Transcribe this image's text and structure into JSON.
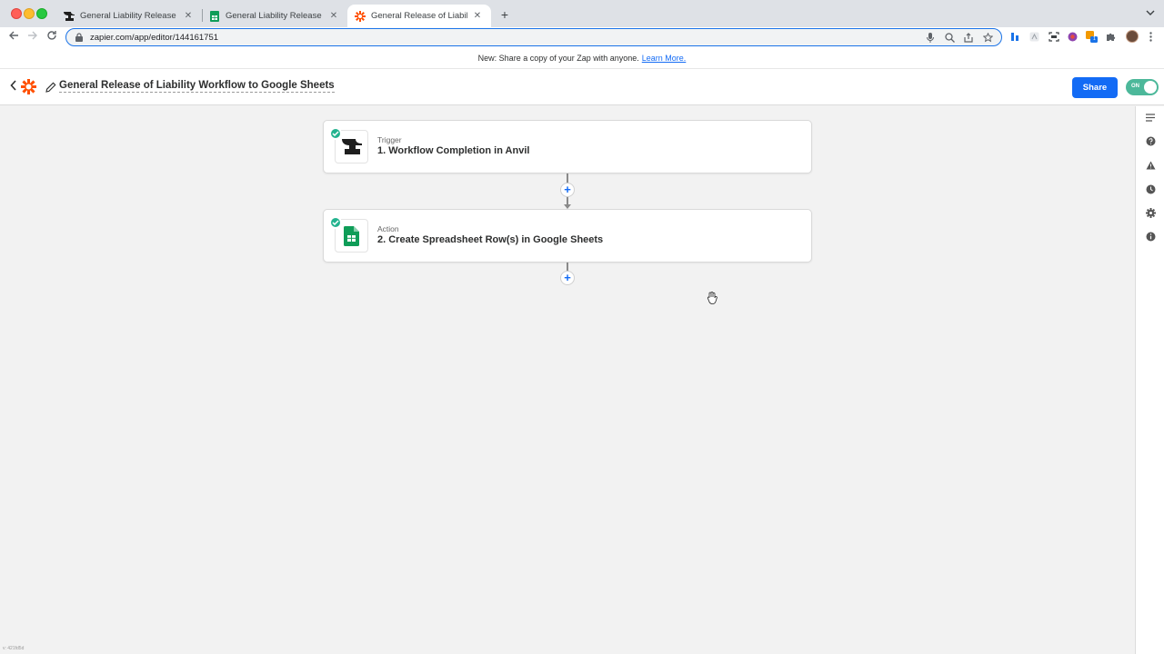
{
  "browser": {
    "tabs": [
      {
        "title": "General Liability Release - Anvil",
        "icon": "anvil-icon",
        "active": false
      },
      {
        "title": "General Liability Release Responses",
        "icon": "google-sheets-icon",
        "active": false
      },
      {
        "title": "General Release of Liability Workflow",
        "icon": "zapier-icon",
        "active": true
      }
    ],
    "close_glyph": "✕",
    "newtab_glyph": "+",
    "url": "zapier.com/app/editor/144161751",
    "extension_badge": "1"
  },
  "announcement": {
    "text": "New: Share a copy of your Zap with anyone.",
    "link": "Learn More."
  },
  "editor": {
    "title": "General Release of Liability Workflow to Google Sheets",
    "share_label": "Share",
    "toggle_label": "ON",
    "toggle_on": true,
    "brand_color": "#ff4f00",
    "accent_color": "#136bf5"
  },
  "steps": [
    {
      "kind": "Trigger",
      "name": "1. Workflow Completion in Anvil",
      "app": "anvil-icon",
      "status": "complete"
    },
    {
      "kind": "Action",
      "name": "2. Create Spreadsheet Row(s) in Google Sheets",
      "app": "google-sheets-icon",
      "status": "complete"
    }
  ],
  "add_step_glyph": "+",
  "rail_icons": [
    "outline-icon",
    "help-icon",
    "warning-icon",
    "history-icon",
    "settings-icon",
    "info-icon"
  ],
  "corner_text": "v: 421fd5d"
}
